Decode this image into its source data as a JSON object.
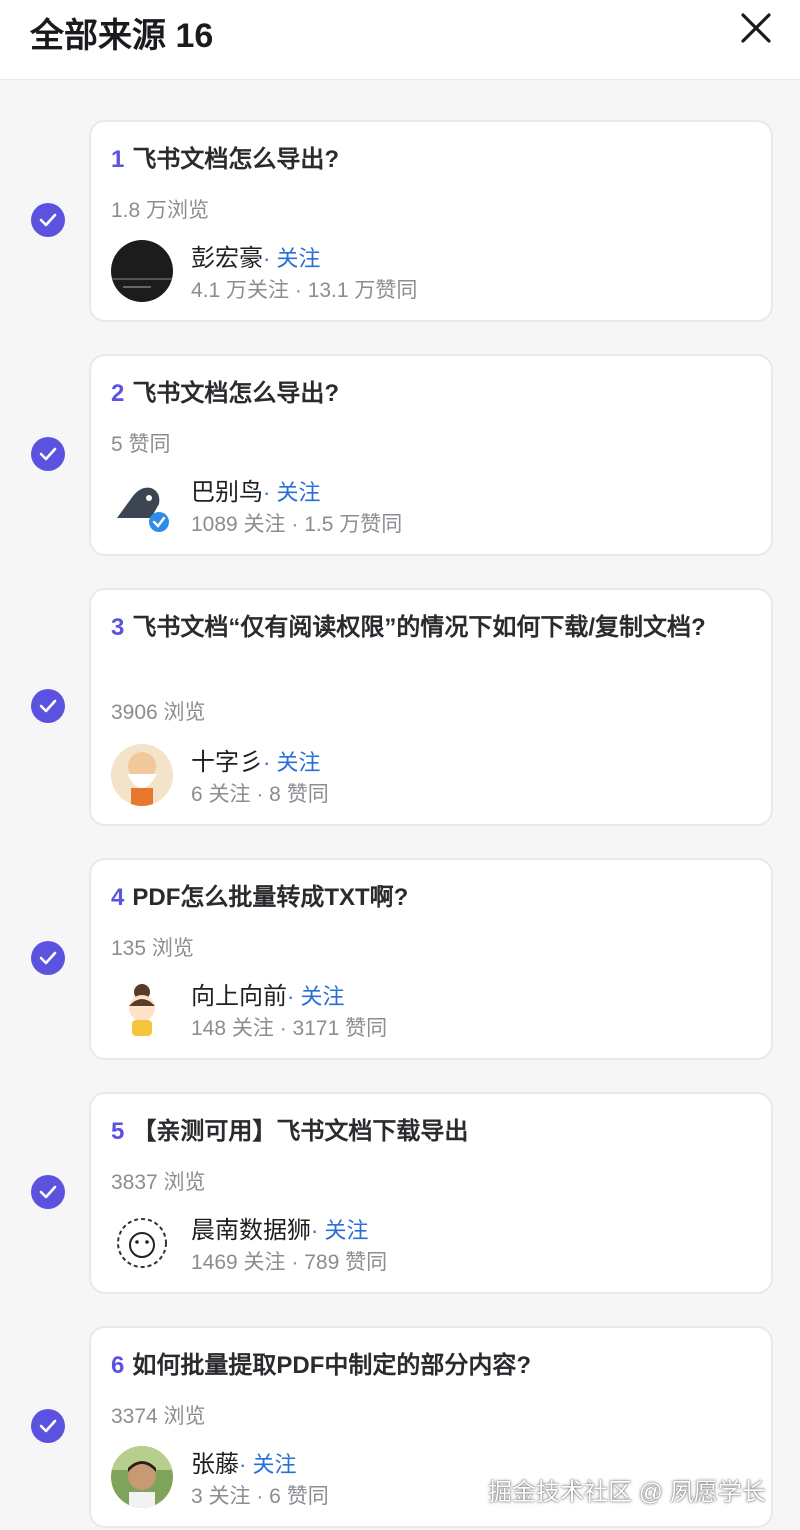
{
  "header": {
    "title": "全部来源 16",
    "close_icon": "close-icon"
  },
  "colors": {
    "accent": "#5b53e0",
    "link": "#2a6fd8",
    "muted": "#8c8c92"
  },
  "sources": [
    {
      "num": "1",
      "question": "飞书文档怎么导出?",
      "stat": "1.8 万浏览",
      "author": "彭宏豪",
      "follow": "· 关注",
      "meta": "4.1 万关注 · 13.1 万赞同",
      "avatar_text": "效率工具指南"
    },
    {
      "num": "2",
      "question": "飞书文档怎么导出?",
      "stat": "5 赞同",
      "author": "巴别鸟",
      "follow": "· 关注",
      "meta": "1089 关注 · 1.5 万赞同"
    },
    {
      "num": "3",
      "question": "飞书文档“仅有阅读权限”的情况下如何下载/复制文档?",
      "stat": "3906 浏览",
      "author": "十字彡",
      "follow": "· 关注",
      "meta": "6 关注 · 8 赞同"
    },
    {
      "num": "4",
      "question": "PDF怎么批量转成TXT啊?",
      "stat": "135 浏览",
      "author": "向上向前",
      "follow": "· 关注",
      "meta": "148 关注 · 3171 赞同"
    },
    {
      "num": "5",
      "question": "【亲测可用】飞书文档下载导出",
      "stat": "3837 浏览",
      "author": "晨南数据狮",
      "follow": "· 关注",
      "meta": "1469 关注 · 789 赞同"
    },
    {
      "num": "6",
      "question": "如何批量提取PDF中制定的部分内容?",
      "stat": "3374 浏览",
      "author": "张藤",
      "follow": "· 关注",
      "meta": "3 关注 · 6 赞同"
    }
  ],
  "watermark": "掘金技术社区 @ 夙愿学长"
}
